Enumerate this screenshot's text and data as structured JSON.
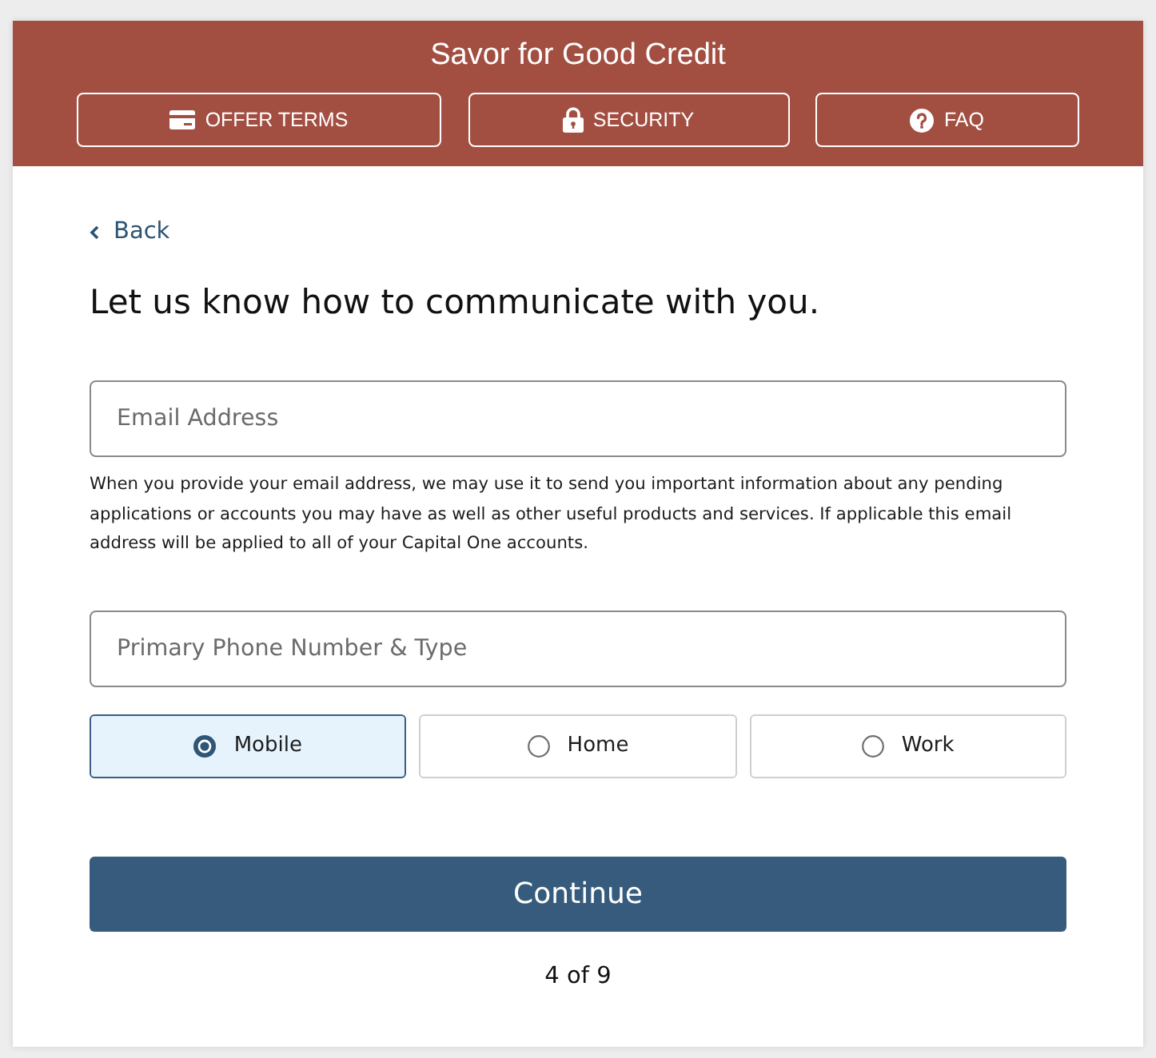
{
  "header": {
    "title": "Savor for Good Credit",
    "buttons": [
      {
        "kind": "card",
        "label": "OFFER TERMS"
      },
      {
        "kind": "lock",
        "label": "SECURITY"
      },
      {
        "kind": "question",
        "label": "FAQ"
      }
    ]
  },
  "back_link": {
    "label": "Back"
  },
  "heading": "Let us know how to communicate with you.",
  "email_field": {
    "placeholder": "Email Address"
  },
  "email_notice": "When you provide your email address, we may use it to send you important information about any pending applications or accounts you may have as well as other useful products and services. If applicable this email address will be applied to all of your Capital One accounts.",
  "phone_field": {
    "placeholder": "Primary Phone Number & Type"
  },
  "phone_types": [
    {
      "label": "Mobile",
      "selected": true
    },
    {
      "label": "Home",
      "selected": false
    },
    {
      "label": "Work",
      "selected": false
    }
  ],
  "continue_button": {
    "label": "Continue"
  },
  "progress": "4 of 9"
}
